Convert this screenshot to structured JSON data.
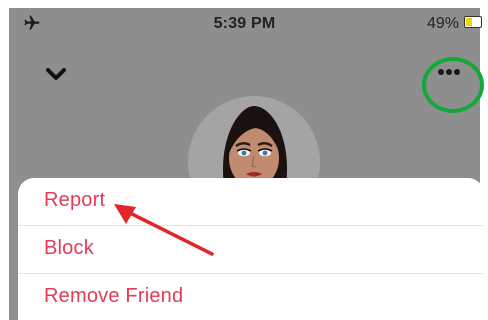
{
  "status_bar": {
    "time": "5:39 PM",
    "battery_percent": "49%",
    "battery_level": 0.49,
    "airplane_icon": "airplane-icon",
    "battery_icon": "battery-icon"
  },
  "header": {
    "back_icon": "chevron-down-icon",
    "more_icon": "more-horizontal-icon"
  },
  "profile": {
    "avatar_icon": "bitmoji-avatar"
  },
  "action_sheet": {
    "items": [
      {
        "label": "Report"
      },
      {
        "label": "Block"
      },
      {
        "label": "Remove Friend"
      }
    ]
  },
  "annotations": {
    "highlight_color": "#12a83a",
    "arrow_color": "#e3262b"
  },
  "colors": {
    "action_text": "#e63a59",
    "overlay": "#8e8e8e"
  }
}
